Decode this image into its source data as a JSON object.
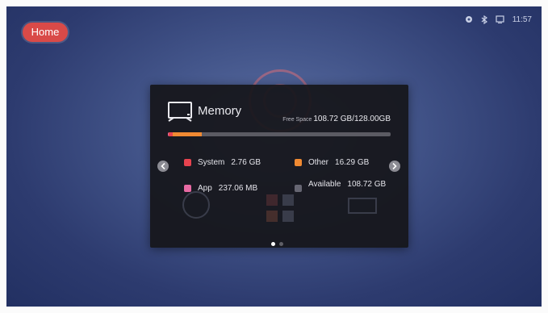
{
  "header": {
    "home_label": "Home",
    "time": "11:57",
    "status_icons": [
      "settings-icon",
      "bluetooth-icon",
      "screen-icon"
    ]
  },
  "memory": {
    "title": "Memory",
    "free_label": "Free Space",
    "free_value": "108.72 GB/128.00GB",
    "usage_fractions": {
      "system": 0.0216,
      "other": 0.127,
      "app": 0.0019
    },
    "items": [
      {
        "name": "System",
        "value": "2.76 GB",
        "color": "#e6434f"
      },
      {
        "name": "Other",
        "value": "16.29 GB",
        "color": "#f08a32"
      },
      {
        "name": "App",
        "value": "237.06 MB",
        "color": "#e76aa3"
      },
      {
        "name": "Available",
        "value": "108.72 GB",
        "color": "#666672"
      }
    ]
  },
  "pagination": {
    "pages": 2,
    "current": 1
  }
}
